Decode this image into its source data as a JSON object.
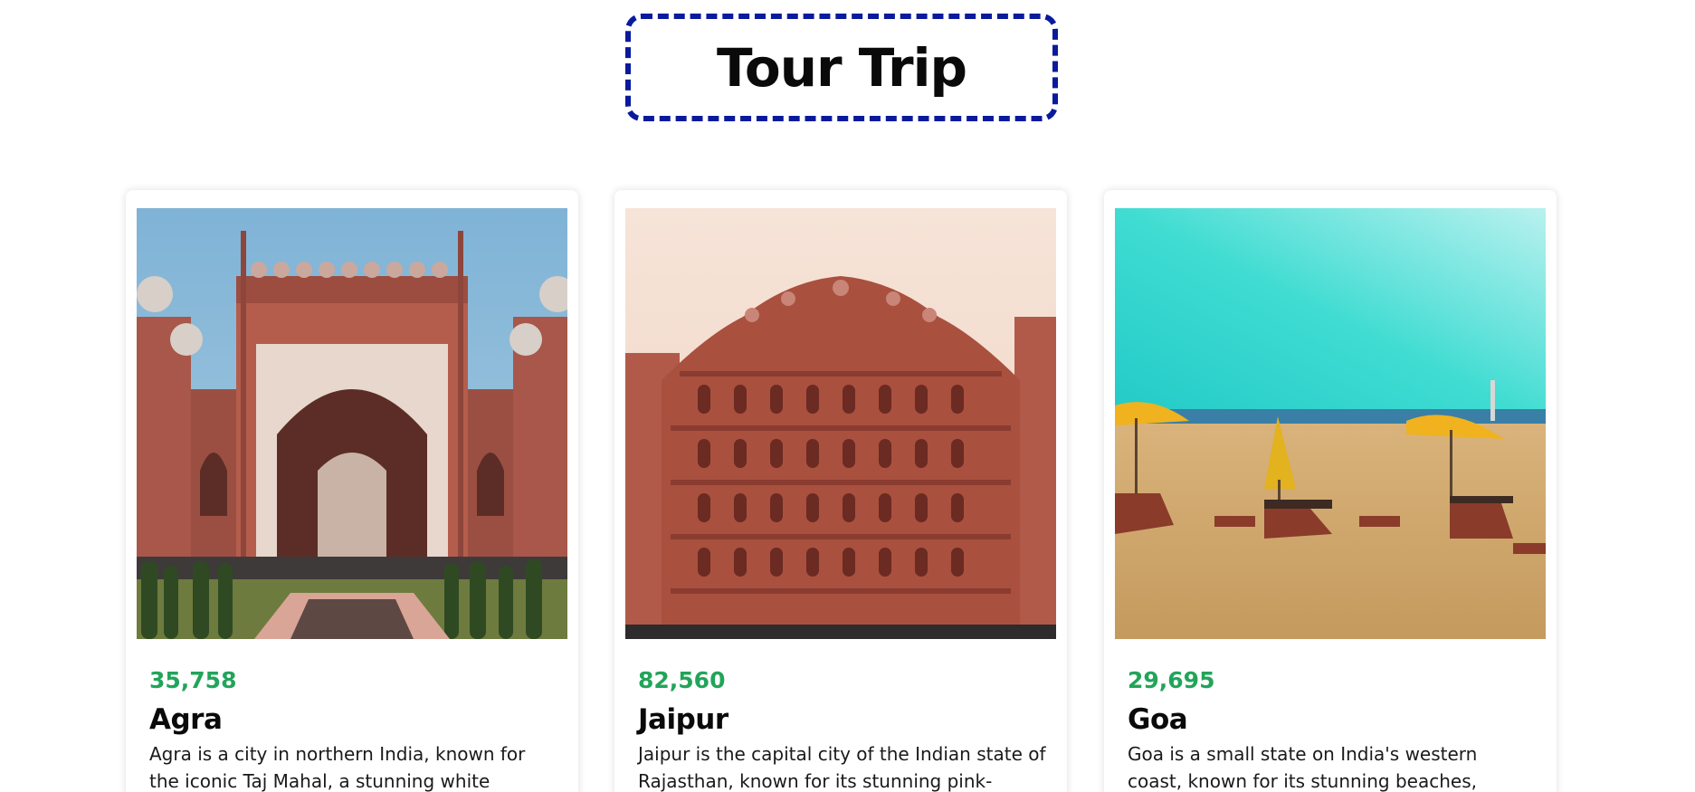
{
  "header": {
    "title": "Tour Trip"
  },
  "colors": {
    "title_border": "#0a1a9c",
    "price": "#22a45a"
  },
  "cards": [
    {
      "price": "35,758",
      "city": "Agra",
      "description": "Agra is a city in northern India, known for the iconic Taj Mahal, a stunning white marble",
      "image": "taj-mahal-gate-photo"
    },
    {
      "price": "82,560",
      "city": "Jaipur",
      "description": "Jaipur is the capital city of the Indian state of Rajasthan, known for its stunning pink-",
      "image": "hawa-mahal-photo"
    },
    {
      "price": "29,695",
      "city": "Goa",
      "description": "Goa is a small state on India's western coast, known for its stunning beaches, vibrant",
      "image": "goa-beach-photo"
    }
  ]
}
